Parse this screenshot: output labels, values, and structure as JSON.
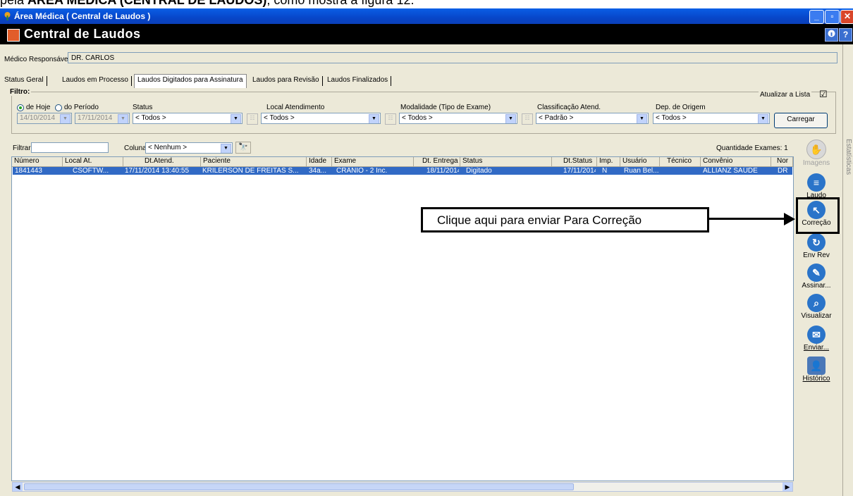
{
  "doc_caption": {
    "prefix": "pela ",
    "bold": "ÁREA MÉDICA (CENTRAL DE LAUDOS)",
    "suffix": ", como mostra a figura 12."
  },
  "window": {
    "title": "Área Médica ( Central de Laudos )",
    "header_title": "Central de Laudos",
    "minimize": "_",
    "maximize": "▫",
    "close": "✕",
    "help_label": "?"
  },
  "medico": {
    "label": "Médico Responsável:",
    "value": "DR. CARLOS"
  },
  "tabs": [
    "Status Geral",
    "Laudos em Processo",
    "Laudos Digitados para Assinatura",
    "Laudos para Revisão",
    "Laudos Finalizados"
  ],
  "filter": {
    "title": "Filtro:",
    "atualizar_label": "Atualizar a Lista",
    "atualizar_checked": "☑",
    "radio_hoje": "de Hoje",
    "radio_periodo": "do Período",
    "date_from": "14/10/2014",
    "date_to": "17/11/2014",
    "status_label": "Status",
    "status_value": "< Todos >",
    "local_label": "Local Atendimento",
    "local_value": "< Todos >",
    "modalidade_label": "Modalidade (Tipo de Exame)",
    "modalidade_value": "< Todos >",
    "classificacao_label": "Classificação Atend.",
    "classificacao_value": "< Padrão >",
    "dep_label": "Dep. de Origem",
    "dep_value": "< Todos >",
    "carregar_label": "Carregar"
  },
  "search": {
    "filtrar_label": "Filtrar:",
    "filtrar_value": "",
    "coluna_label": "Coluna:",
    "coluna_value": "< Nenhum >",
    "quantidade": "Quantidade Exames: 1"
  },
  "table": {
    "columns": [
      "Número",
      "Local At.",
      "Dt.Atend.",
      "Paciente",
      "Idade",
      "Exame",
      "Dt. Entrega",
      "Status",
      "Dt.Status",
      "Imp.",
      "Usuário",
      "Técnico",
      "Convênio",
      "Nor"
    ],
    "rows": [
      [
        "1841443",
        "CSOFTW...",
        "17/11/2014 13:40:55",
        "KRILERSON DE FREITAS S...",
        "34a...",
        "CRÂNIO - 2 Inc.",
        "18/11/2014",
        "Digitado",
        "17/11/2014",
        "N",
        "Ruan Bel...",
        "",
        "ALLIANZ SAÚDE",
        "DR"
      ]
    ]
  },
  "side_actions": [
    {
      "label": "Imagens",
      "icon": "hand-icon",
      "enabled": false,
      "color": "#cccccc"
    },
    {
      "label": "Laudo",
      "icon": "document-icon",
      "enabled": true,
      "color": "#2a74c9"
    },
    {
      "label": "Correção",
      "icon": "cursor-icon",
      "enabled": true,
      "color": "#2a74c9"
    },
    {
      "label": "Env Rev",
      "icon": "send-review-icon",
      "enabled": true,
      "color": "#2a74c9"
    },
    {
      "label": "Assinar...",
      "icon": "sign-icon",
      "enabled": true,
      "color": "#2a74c9"
    },
    {
      "label": "Visualizar",
      "icon": "magnifier-icon",
      "enabled": true,
      "color": "#2a74c9"
    },
    {
      "label": "Enviar...",
      "icon": "envelope-icon",
      "enabled": true,
      "color": "#2a74c9"
    },
    {
      "label": "Histórico",
      "icon": "person-history-icon",
      "enabled": true,
      "color": "#4a78b8"
    }
  ],
  "right_strip": "Estatísticas",
  "annotation": "Clique aqui para enviar Para Correção",
  "colors": {
    "titlebar": "#0746c9",
    "selection": "#316ac5",
    "panel": "#ece9d8"
  }
}
